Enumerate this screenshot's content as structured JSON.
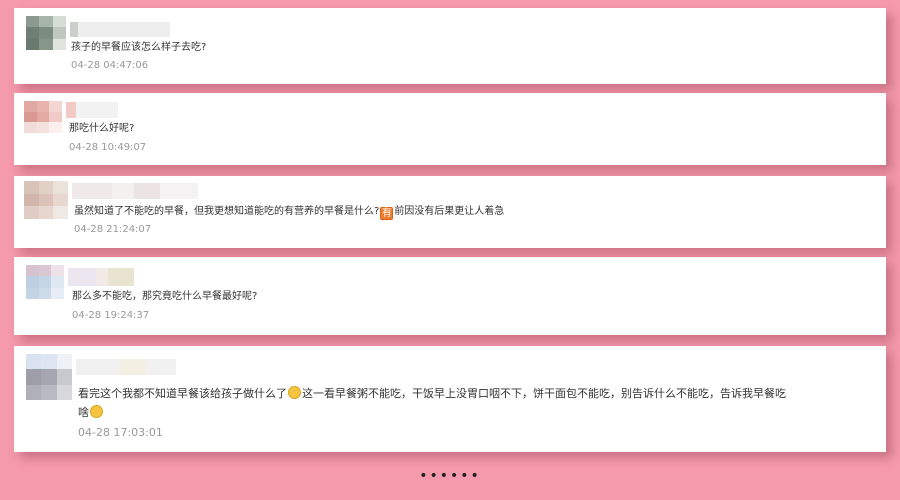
{
  "comments": [
    {
      "text": "孩子的早餐应该怎么样子去吃?",
      "time": "04-28 04:47:06"
    },
    {
      "text": "那吃什么好呢?",
      "time": "04-28 10:49:07"
    },
    {
      "text_before": "虽然知道了不能吃的早餐，但我更想知道能吃的有营养的早餐是什么?",
      "badge": "有",
      "text_after": "前因没有后果更让人着急",
      "time": "04-28 21:24:07"
    },
    {
      "text": "那么多不能吃，那究竟吃什么早餐最好呢?",
      "time": "04-28 19:24:37"
    },
    {
      "text_before": "看完这个我都不知道早餐该给孩子做什么了",
      "text_mid": "这一看早餐粥不能吃，干饭早上没胃口咽不下，饼干面包不能吃，别告诉什么不能吃，告诉我早餐吃",
      "text_last": "啥",
      "time": "04-28 17:03:01"
    }
  ],
  "icons": {
    "emoji_1": "confused-face-icon",
    "emoji_2": "thinking-face-icon",
    "badge_icon": "you-badge-icon"
  },
  "more_indicator": "••••••",
  "colors": {
    "background": "#f59aac",
    "card": "#ffffff",
    "time": "#999999"
  }
}
